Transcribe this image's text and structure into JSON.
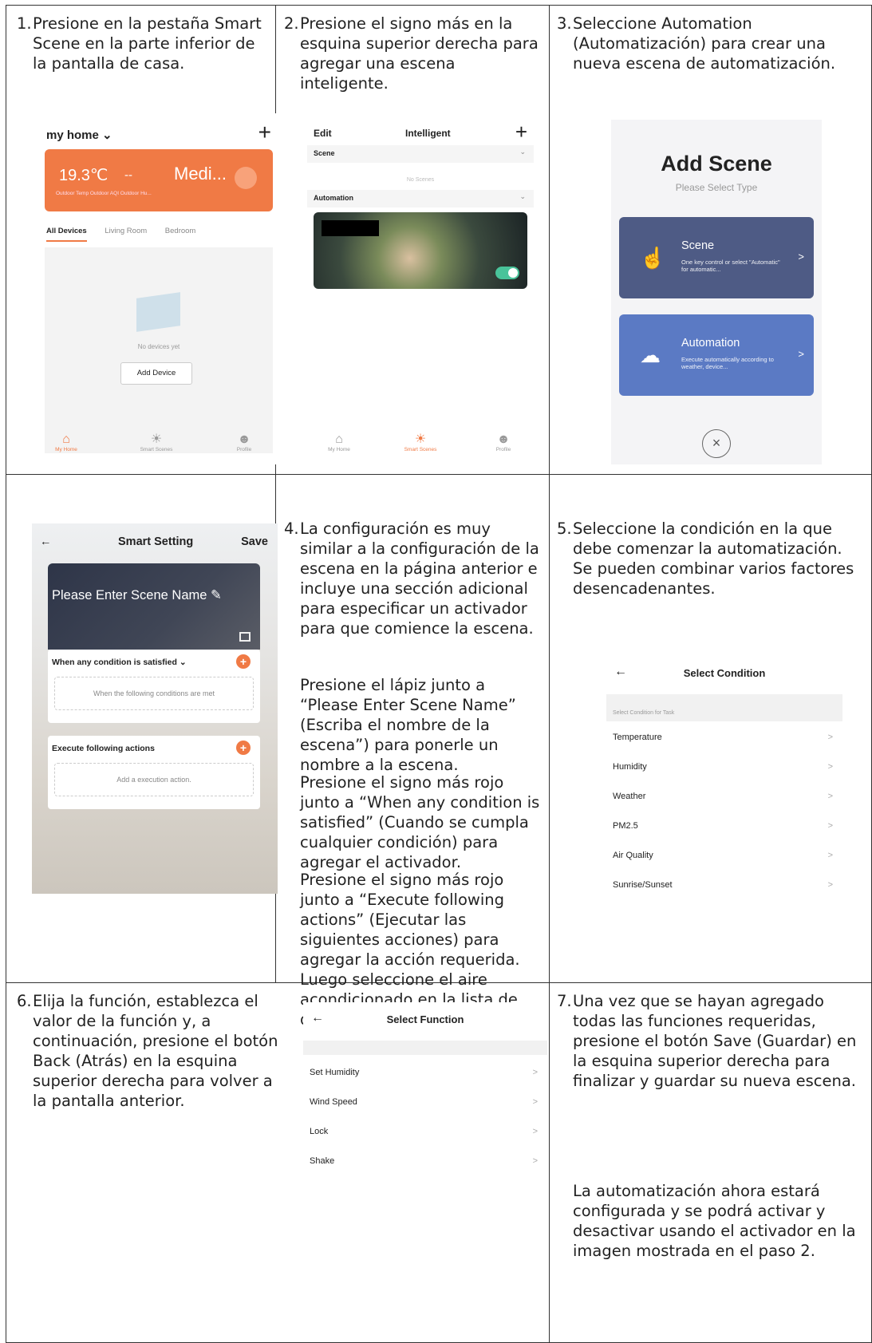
{
  "steps": [
    {
      "num": "1.",
      "text": "Presione en la pestaña Smart Scene en la parte inferior de la pantalla de casa."
    },
    {
      "num": "2.",
      "text": "Presione el signo más en la esquina superior derecha para agregar una escena inteligente."
    },
    {
      "num": "3.",
      "text": "Seleccione Automation (Automatización) para crear una nueva escena de automatización."
    },
    {
      "num": "4.",
      "text": "La configuración es muy similar a la configuración de la escena en la página anterior e incluye una sección adicional para especificar un activador para que comience la escena."
    },
    {
      "num": "5.",
      "text": "Seleccione la condición en la que debe comenzar la automatización. Se pueden combinar varios factores desencadenantes."
    },
    {
      "num": "6.",
      "text": "Elija la función, establezca el valor de la función y, a continuación, presione el botón Back (Atrás) en la esquina superior derecha para volver a la pantalla anterior."
    },
    {
      "num": "7.",
      "text": "Una vez que se hayan agregado todas las funciones requeridas, presione el botón Save (Guardar) en la esquina superior derecha para finalizar y guardar su nueva escena."
    }
  ],
  "step4_paragraphs": [
    "Presione el lápiz junto a “Please Enter Scene Name” (Escriba el nombre de la escena”) para ponerle un nombre a la escena.",
    "Presione el signo más rojo junto a “When any condition is satisfied” (Cuando se cumpla cualquier condición) para agregar el activador.",
    "Presione el signo más rojo junto a “Execute following actions” (Ejecutar las siguientes acciones) para agregar la acción requerida. Luego seleccione el aire acondicionado en la lista de dispositivos."
  ],
  "step7_paragraph": "La automatización ahora estará configurada y se podrá activar y desactivar usando el activador en la imagen mostrada en el paso 2.",
  "screen1": {
    "title": "my home ⌄",
    "plus": "+",
    "temp": "19.3℃",
    "dash": "--",
    "medi": "Medi...",
    "card_labels": "Outdoor Temp    Outdoor AQI    Outdoor Hu...",
    "tabs": [
      "All Devices",
      "Living Room",
      "Bedroom"
    ],
    "empty_text": "No devices yet",
    "add_device": "Add Device",
    "nav": [
      "My Home",
      "Smart Scenes",
      "Profile"
    ]
  },
  "screen2": {
    "edit": "Edit",
    "title": "Intelligent",
    "plus": "+",
    "scene": "Scene",
    "no_scenes": "No Scenes",
    "automation": "Automation",
    "nav": [
      "My Home",
      "Smart Scenes",
      "Profile"
    ]
  },
  "screen3": {
    "title": "Add Scene",
    "subtitle": "Please Select Type",
    "scene_title": "Scene",
    "scene_desc": "One key control or select \"Automatic\" for automatic...",
    "auto_title": "Automation",
    "auto_desc": "Execute automatically according to weather, device...",
    "arrow": ">",
    "close": "×"
  },
  "screen4": {
    "back": "←",
    "title": "Smart Setting",
    "save": "Save",
    "name": "Please Enter Scene Name ✎",
    "cond_header": "When any condition is satisfied ⌄",
    "cond_text": "When the following conditions are met",
    "act_header": "Execute following actions",
    "act_text": "Add a execution action."
  },
  "screen5": {
    "back": "←",
    "title": "Select Condition",
    "band": "Select Condition for Task",
    "items": [
      "Temperature",
      "Humidity",
      "Weather",
      "PM2.5",
      "Air Quality",
      "Sunrise/Sunset"
    ],
    "arrow": ">"
  },
  "screen6": {
    "back": "←",
    "title": "Select Function",
    "items": [
      "Set Humidity",
      "Wind Speed",
      "Lock",
      "Shake"
    ],
    "arrow": ">"
  },
  "colors": {
    "accent": "#f07a45",
    "scene_card": "#4e5b85",
    "automation_card": "#5b7ac4",
    "toggle": "#49c39a"
  }
}
